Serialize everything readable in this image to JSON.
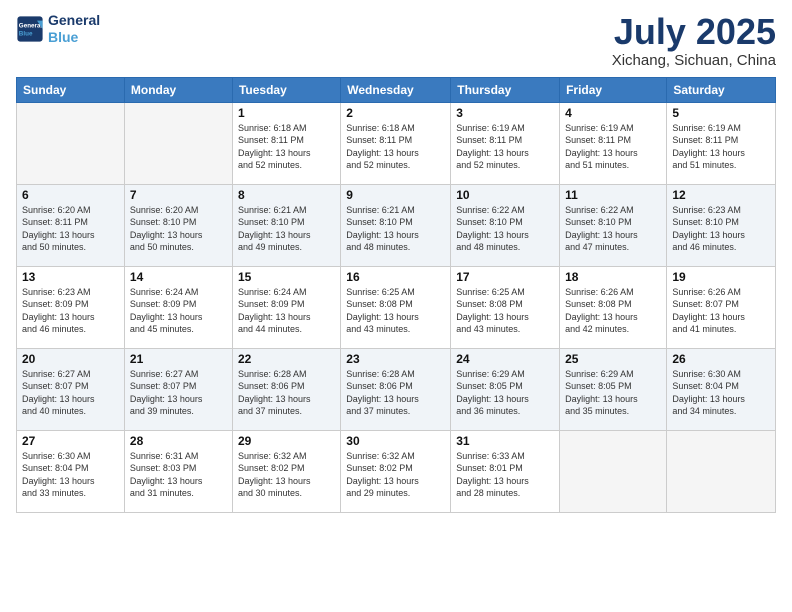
{
  "header": {
    "logo_line1": "General",
    "logo_line2": "Blue",
    "month": "July 2025",
    "location": "Xichang, Sichuan, China"
  },
  "weekdays": [
    "Sunday",
    "Monday",
    "Tuesday",
    "Wednesday",
    "Thursday",
    "Friday",
    "Saturday"
  ],
  "weeks": [
    [
      {
        "day": "",
        "detail": ""
      },
      {
        "day": "",
        "detail": ""
      },
      {
        "day": "1",
        "detail": "Sunrise: 6:18 AM\nSunset: 8:11 PM\nDaylight: 13 hours\nand 52 minutes."
      },
      {
        "day": "2",
        "detail": "Sunrise: 6:18 AM\nSunset: 8:11 PM\nDaylight: 13 hours\nand 52 minutes."
      },
      {
        "day": "3",
        "detail": "Sunrise: 6:19 AM\nSunset: 8:11 PM\nDaylight: 13 hours\nand 52 minutes."
      },
      {
        "day": "4",
        "detail": "Sunrise: 6:19 AM\nSunset: 8:11 PM\nDaylight: 13 hours\nand 51 minutes."
      },
      {
        "day": "5",
        "detail": "Sunrise: 6:19 AM\nSunset: 8:11 PM\nDaylight: 13 hours\nand 51 minutes."
      }
    ],
    [
      {
        "day": "6",
        "detail": "Sunrise: 6:20 AM\nSunset: 8:11 PM\nDaylight: 13 hours\nand 50 minutes."
      },
      {
        "day": "7",
        "detail": "Sunrise: 6:20 AM\nSunset: 8:10 PM\nDaylight: 13 hours\nand 50 minutes."
      },
      {
        "day": "8",
        "detail": "Sunrise: 6:21 AM\nSunset: 8:10 PM\nDaylight: 13 hours\nand 49 minutes."
      },
      {
        "day": "9",
        "detail": "Sunrise: 6:21 AM\nSunset: 8:10 PM\nDaylight: 13 hours\nand 48 minutes."
      },
      {
        "day": "10",
        "detail": "Sunrise: 6:22 AM\nSunset: 8:10 PM\nDaylight: 13 hours\nand 48 minutes."
      },
      {
        "day": "11",
        "detail": "Sunrise: 6:22 AM\nSunset: 8:10 PM\nDaylight: 13 hours\nand 47 minutes."
      },
      {
        "day": "12",
        "detail": "Sunrise: 6:23 AM\nSunset: 8:10 PM\nDaylight: 13 hours\nand 46 minutes."
      }
    ],
    [
      {
        "day": "13",
        "detail": "Sunrise: 6:23 AM\nSunset: 8:09 PM\nDaylight: 13 hours\nand 46 minutes."
      },
      {
        "day": "14",
        "detail": "Sunrise: 6:24 AM\nSunset: 8:09 PM\nDaylight: 13 hours\nand 45 minutes."
      },
      {
        "day": "15",
        "detail": "Sunrise: 6:24 AM\nSunset: 8:09 PM\nDaylight: 13 hours\nand 44 minutes."
      },
      {
        "day": "16",
        "detail": "Sunrise: 6:25 AM\nSunset: 8:08 PM\nDaylight: 13 hours\nand 43 minutes."
      },
      {
        "day": "17",
        "detail": "Sunrise: 6:25 AM\nSunset: 8:08 PM\nDaylight: 13 hours\nand 43 minutes."
      },
      {
        "day": "18",
        "detail": "Sunrise: 6:26 AM\nSunset: 8:08 PM\nDaylight: 13 hours\nand 42 minutes."
      },
      {
        "day": "19",
        "detail": "Sunrise: 6:26 AM\nSunset: 8:07 PM\nDaylight: 13 hours\nand 41 minutes."
      }
    ],
    [
      {
        "day": "20",
        "detail": "Sunrise: 6:27 AM\nSunset: 8:07 PM\nDaylight: 13 hours\nand 40 minutes."
      },
      {
        "day": "21",
        "detail": "Sunrise: 6:27 AM\nSunset: 8:07 PM\nDaylight: 13 hours\nand 39 minutes."
      },
      {
        "day": "22",
        "detail": "Sunrise: 6:28 AM\nSunset: 8:06 PM\nDaylight: 13 hours\nand 37 minutes."
      },
      {
        "day": "23",
        "detail": "Sunrise: 6:28 AM\nSunset: 8:06 PM\nDaylight: 13 hours\nand 37 minutes."
      },
      {
        "day": "24",
        "detail": "Sunrise: 6:29 AM\nSunset: 8:05 PM\nDaylight: 13 hours\nand 36 minutes."
      },
      {
        "day": "25",
        "detail": "Sunrise: 6:29 AM\nSunset: 8:05 PM\nDaylight: 13 hours\nand 35 minutes."
      },
      {
        "day": "26",
        "detail": "Sunrise: 6:30 AM\nSunset: 8:04 PM\nDaylight: 13 hours\nand 34 minutes."
      }
    ],
    [
      {
        "day": "27",
        "detail": "Sunrise: 6:30 AM\nSunset: 8:04 PM\nDaylight: 13 hours\nand 33 minutes."
      },
      {
        "day": "28",
        "detail": "Sunrise: 6:31 AM\nSunset: 8:03 PM\nDaylight: 13 hours\nand 31 minutes."
      },
      {
        "day": "29",
        "detail": "Sunrise: 6:32 AM\nSunset: 8:02 PM\nDaylight: 13 hours\nand 30 minutes."
      },
      {
        "day": "30",
        "detail": "Sunrise: 6:32 AM\nSunset: 8:02 PM\nDaylight: 13 hours\nand 29 minutes."
      },
      {
        "day": "31",
        "detail": "Sunrise: 6:33 AM\nSunset: 8:01 PM\nDaylight: 13 hours\nand 28 minutes."
      },
      {
        "day": "",
        "detail": ""
      },
      {
        "day": "",
        "detail": ""
      }
    ]
  ]
}
